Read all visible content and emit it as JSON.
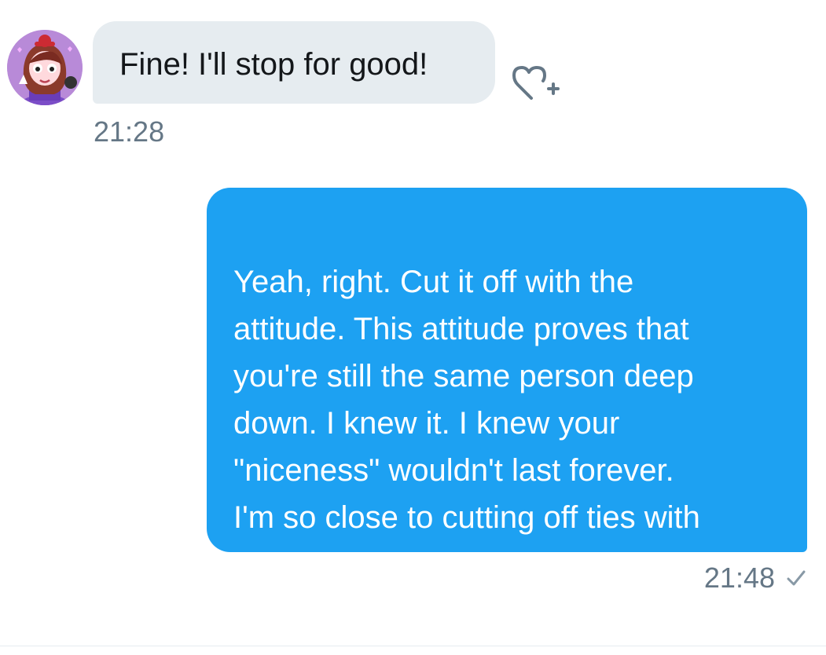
{
  "conversation": {
    "incoming": {
      "text": "Fine! I'll stop for good!",
      "time": "21:28",
      "avatar_icon": "avatar-icon",
      "reaction_icon": "heart-plus-icon"
    },
    "outgoing": {
      "text": "Yeah, right. Cut it off with the\nattitude. This attitude proves that\nyou're still the same person deep\ndown. I knew it. I knew your\n\"niceness\" wouldn't last forever.\nI'm so close to cutting off ties with\nyou.",
      "time": "21:48",
      "status_icon": "check-icon"
    }
  },
  "colors": {
    "incoming_bubble": "#e6ecf0",
    "outgoing_bubble": "#1da1f2",
    "timestamp": "#657786",
    "incoming_text": "#14171a",
    "outgoing_text": "#ffffff"
  }
}
